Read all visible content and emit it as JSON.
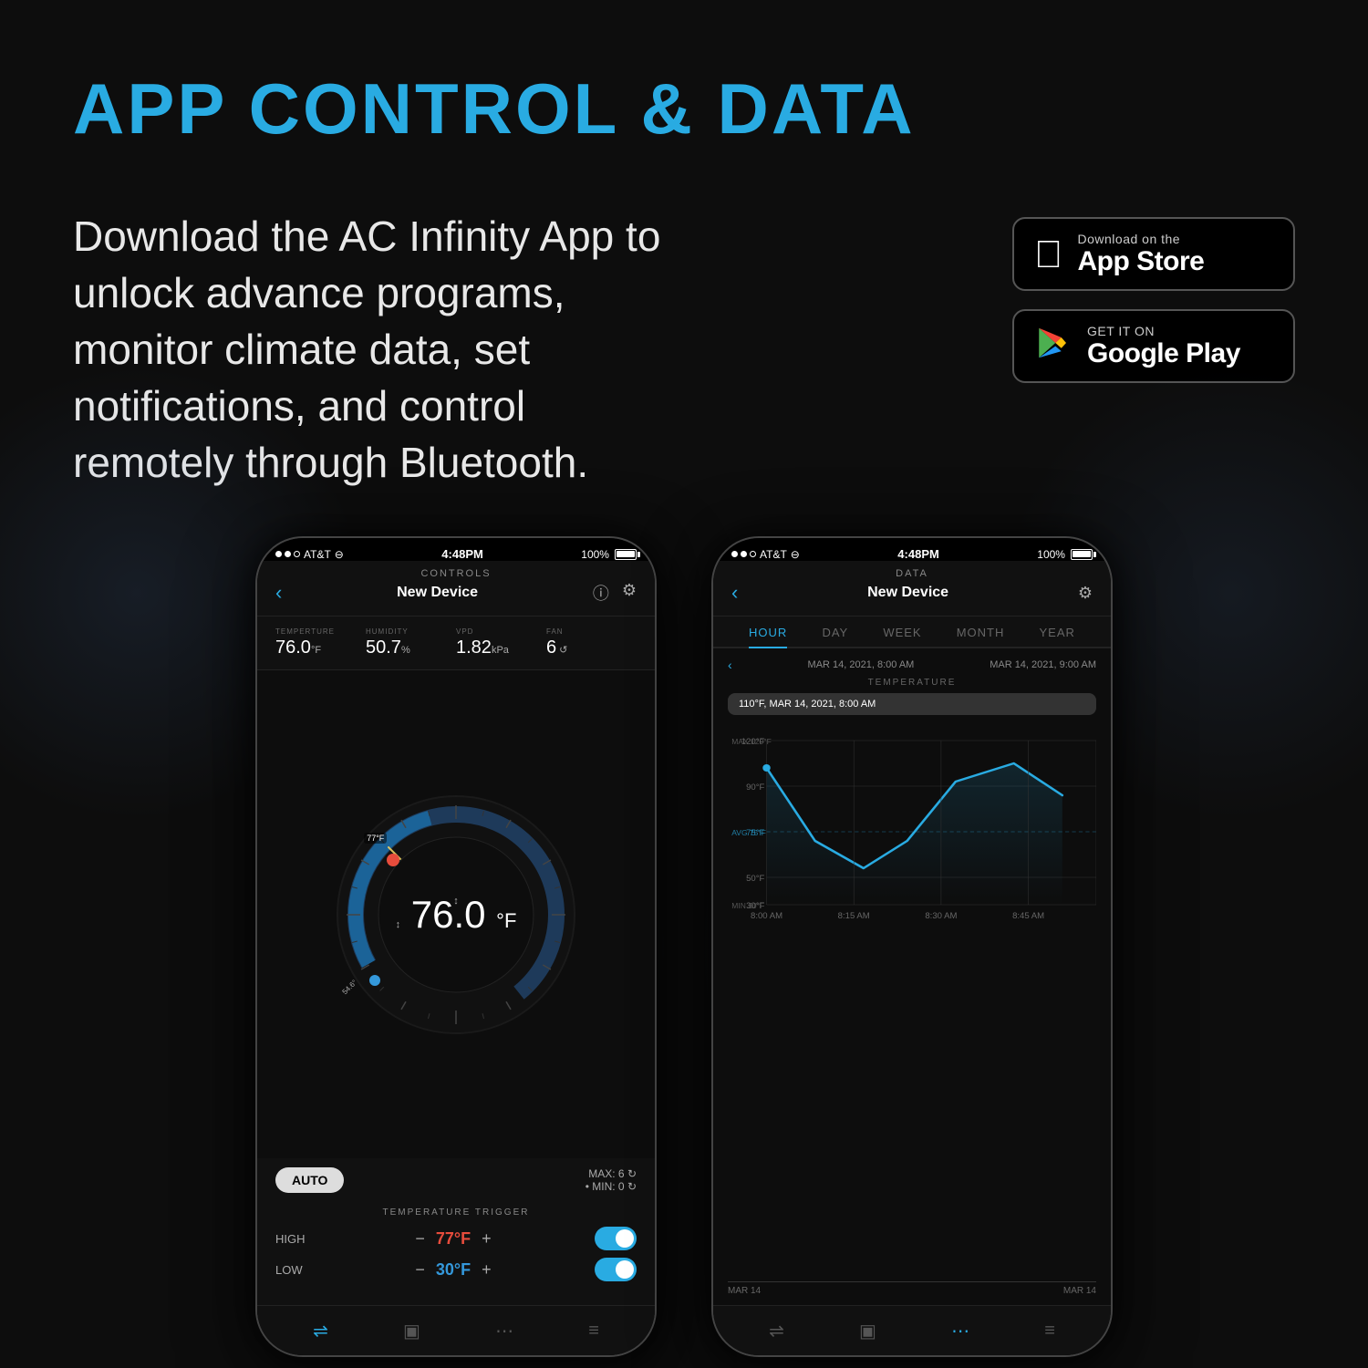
{
  "page": {
    "background": "#0d0d0d"
  },
  "header": {
    "title": "APP CONTROL & DATA",
    "title_color": "#29abe2"
  },
  "description": {
    "text": "Download the AC Infinity App to unlock advance programs, monitor climate data, set notifications, and control remotely through Bluetooth."
  },
  "badges": {
    "appstore": {
      "small_text": "Download on the",
      "large_text": "App Store",
      "icon": "apple"
    },
    "googleplay": {
      "small_text": "GET IT ON",
      "large_text": "Google Play",
      "icon": "play"
    }
  },
  "phone_left": {
    "status": {
      "carrier": "AT&T",
      "time": "4:48PM",
      "battery": "100%"
    },
    "screen_title": "CONTROLS",
    "device_name": "New Device",
    "stats": {
      "temperature": {
        "label": "TEMPERTURE",
        "value": "76.0",
        "unit": "°F"
      },
      "humidity": {
        "label": "HUMIDITY",
        "value": "50.7",
        "unit": "%"
      },
      "vpd": {
        "label": "VPD",
        "value": "1.82",
        "unit": "kPa"
      },
      "fan": {
        "label": "FAN",
        "value": "6"
      }
    },
    "gauge": {
      "value": "76.0",
      "unit": "°F",
      "red_label": "77°F",
      "blue_label": "54.6°"
    },
    "controls": {
      "mode": "AUTO",
      "fan_max": "MAX: 6",
      "fan_min": "MIN: 0"
    },
    "temp_trigger": {
      "title": "TEMPERATURE TRIGGER",
      "high": {
        "label": "HIGH",
        "value": "77°F"
      },
      "low": {
        "label": "LOW",
        "value": "30°F"
      }
    }
  },
  "phone_right": {
    "status": {
      "carrier": "AT&T",
      "time": "4:48PM",
      "battery": "100%"
    },
    "screen_title": "DATA",
    "device_name": "New Device",
    "tabs": [
      "HOUR",
      "DAY",
      "WEEK",
      "MONTH",
      "YEAR"
    ],
    "active_tab": "HOUR",
    "date_range": {
      "start": "MAR 14, 2021, 8:00 AM",
      "end": "MAR 14, 2021, 9:00 AM"
    },
    "chart_title": "TEMPERATURE",
    "tooltip": "110°F, MAR 14, 2021, 8:00 AM",
    "chart_labels": {
      "max": "MAX 120°F",
      "avg": "AVG 75°F",
      "min": "MIN 30°F"
    },
    "x_labels": [
      "8:00 AM",
      "8:15 AM",
      "8:30 AM",
      "8:45 AM"
    ],
    "date_footer": {
      "start": "MAR 14",
      "end": "MAR 14"
    },
    "chart_data": {
      "points": [
        110,
        55,
        40,
        55,
        95,
        105,
        90
      ],
      "avg_line": 75,
      "max": 120,
      "min": 30
    }
  }
}
